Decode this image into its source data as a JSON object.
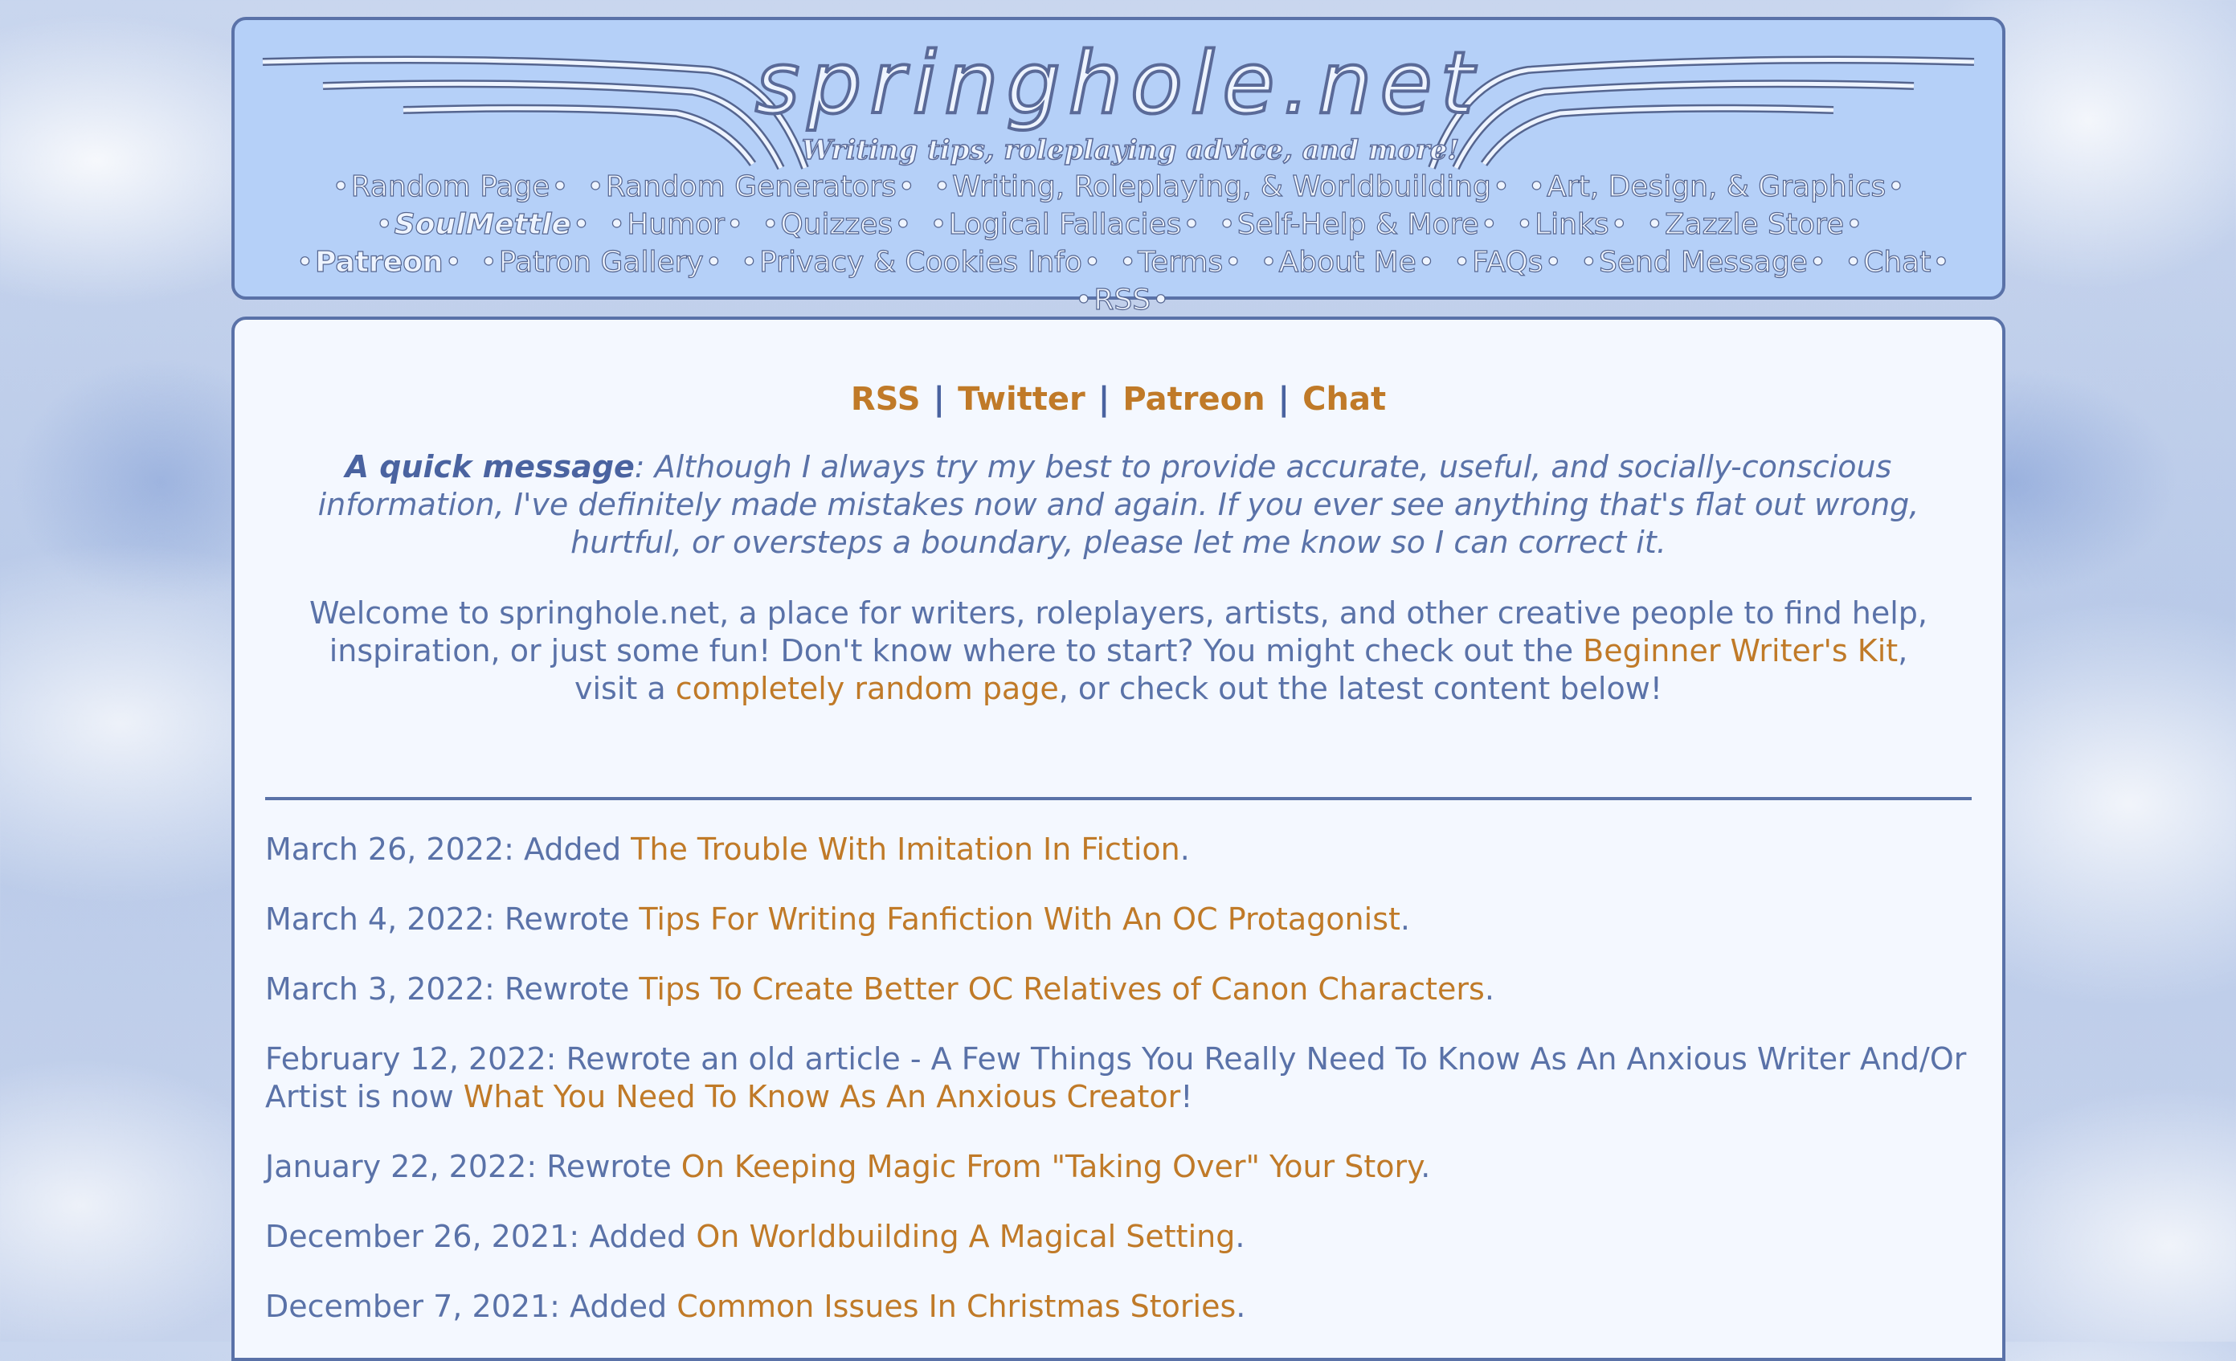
{
  "site": {
    "logo_title": "springhole.net",
    "tagline": "Writing tips, roleplaying advice, and more!"
  },
  "nav": [
    {
      "label": "Random Page"
    },
    {
      "label": "Random Generators"
    },
    {
      "label": "Writing, Roleplaying, & Worldbuilding"
    },
    {
      "label": "Art, Design, & Graphics"
    },
    {
      "label": "SoulMettle"
    },
    {
      "label": "Humor"
    },
    {
      "label": "Quizzes"
    },
    {
      "label": "Logical Fallacies"
    },
    {
      "label": "Self-Help & More"
    },
    {
      "label": "Links"
    },
    {
      "label": "Zazzle Store"
    },
    {
      "label": "Patreon"
    },
    {
      "label": "Patron Gallery"
    },
    {
      "label": "Privacy & Cookies Info"
    },
    {
      "label": "Terms"
    },
    {
      "label": "About Me"
    },
    {
      "label": "FAQs"
    },
    {
      "label": "Send Message"
    },
    {
      "label": "Chat"
    },
    {
      "label": "RSS"
    }
  ],
  "top_links": [
    {
      "label": "RSS"
    },
    {
      "label": "Twitter"
    },
    {
      "label": "Patreon"
    },
    {
      "label": "Chat"
    }
  ],
  "top_links_separator": "|",
  "quick_message": {
    "label": "A quick message",
    "text": ": Although I always try my best to provide accurate, useful, and socially-conscious information, I've definitely made mistakes now and again. If you ever see anything that's flat out wrong, hurtful, or oversteps a boundary, please let me know so I can correct it."
  },
  "welcome": {
    "part1": "Welcome to springhole.net, a place for writers, roleplayers, artists, and other creative people to find help, inspiration, or just some fun! Don't know where to start? You might check out the ",
    "link1": "Beginner Writer's Kit",
    "part2": ", visit a ",
    "link2": "completely random page",
    "part3": ", or check out the latest content below!"
  },
  "updates": [
    {
      "prefix": "March 26, 2022: Added ",
      "link": "The Trouble With Imitation In Fiction",
      "suffix": "."
    },
    {
      "prefix": "March 4, 2022: Rewrote ",
      "link": "Tips For Writing Fanfiction With An OC Protagonist",
      "suffix": "."
    },
    {
      "prefix": "March 3, 2022: Rewrote ",
      "link": "Tips To Create Better OC Relatives of Canon Characters",
      "suffix": "."
    },
    {
      "prefix": "February 12, 2022: Rewrote an old article - A Few Things You Really Need To Know As An Anxious Writer And/Or Artist is now ",
      "link": "What You Need To Know As An Anxious Creator",
      "suffix": "!"
    },
    {
      "prefix": "January 22, 2022: Rewrote ",
      "link": "On Keeping Magic From \"Taking Over\" Your Story",
      "suffix": "."
    },
    {
      "prefix": "December 26, 2021: Added ",
      "link": "On Worldbuilding A Magical Setting",
      "suffix": "."
    },
    {
      "prefix": "December 7, 2021: Added ",
      "link": "Common Issues In Christmas Stories",
      "suffix": "."
    }
  ],
  "colors": {
    "link": "#c07a28",
    "text": "#5a72a8",
    "border": "#5a72a8",
    "header_bg": "#b5d0f8",
    "content_bg": "#f4f8ff"
  }
}
